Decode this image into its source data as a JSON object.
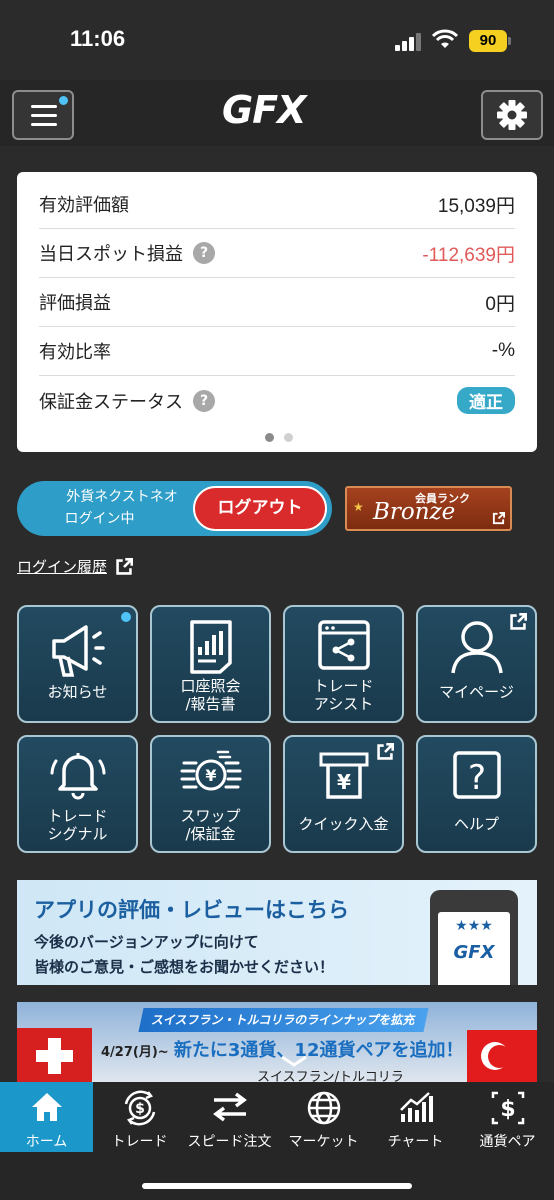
{
  "status_bar": {
    "time": "11:06",
    "battery": "90"
  },
  "header": {
    "logo": "GFX"
  },
  "summary": {
    "rows": [
      {
        "label": "有効評価額",
        "value": "15,039円"
      },
      {
        "label": "当日スポット損益",
        "value": "-112,639円"
      },
      {
        "label": "評価損益",
        "value": "0円"
      },
      {
        "label": "有効比率",
        "value": "-%"
      },
      {
        "label": "保証金ステータス",
        "value": "適正"
      }
    ],
    "help_mark": "?",
    "colors": {
      "negative": "#e05a5a",
      "badge": "#36a9c9"
    }
  },
  "login": {
    "line1": "外貨ネクストネオ",
    "line2": "ログイン中",
    "logout_label": "ログアウト"
  },
  "rank": {
    "label": "会員ランク",
    "value": "Bronze"
  },
  "login_history": "ログイン履歴",
  "tiles": [
    {
      "label": "お知らせ",
      "icon": "megaphone-icon"
    },
    {
      "label_lines": [
        "口座照会",
        "/報告書"
      ],
      "icon": "report-icon"
    },
    {
      "label_lines": [
        "トレード",
        "アシスト"
      ],
      "icon": "share-window-icon"
    },
    {
      "label": "マイページ",
      "icon": "user-icon"
    },
    {
      "label_lines": [
        "トレード",
        "シグナル"
      ],
      "icon": "bell-icon"
    },
    {
      "label_lines": [
        "スワップ",
        "/保証金"
      ],
      "icon": "yen-coins-icon"
    },
    {
      "label": "クイック入金",
      "icon": "atm-yen-icon"
    },
    {
      "label": "ヘルプ",
      "icon": "question-icon"
    }
  ],
  "banner_review": {
    "title": "アプリの評価・レビューはこちら",
    "line1": "今後のバージョンアップに向けて",
    "line2": "皆様のご意見・ご感想をお聞かせください！",
    "logo": "GFX"
  },
  "banner_lineup": {
    "header": "スイスフラン・トルコリラのラインナップを拡充",
    "date": "4/27(月)~",
    "main": "新たに3通貨、12通貨ペアを追加！",
    "sub": "スイスフラン/トルコリラ"
  },
  "nav": [
    {
      "label": "ホーム",
      "icon": "home-icon",
      "active": true
    },
    {
      "label": "トレード",
      "icon": "trade-dollar-icon"
    },
    {
      "label": "スピード注文",
      "icon": "speed-order-icon"
    },
    {
      "label": "マーケット",
      "icon": "globe-icon"
    },
    {
      "label": "チャート",
      "icon": "chart-icon"
    },
    {
      "label": "通貨ペア",
      "icon": "currency-pair-icon"
    }
  ]
}
